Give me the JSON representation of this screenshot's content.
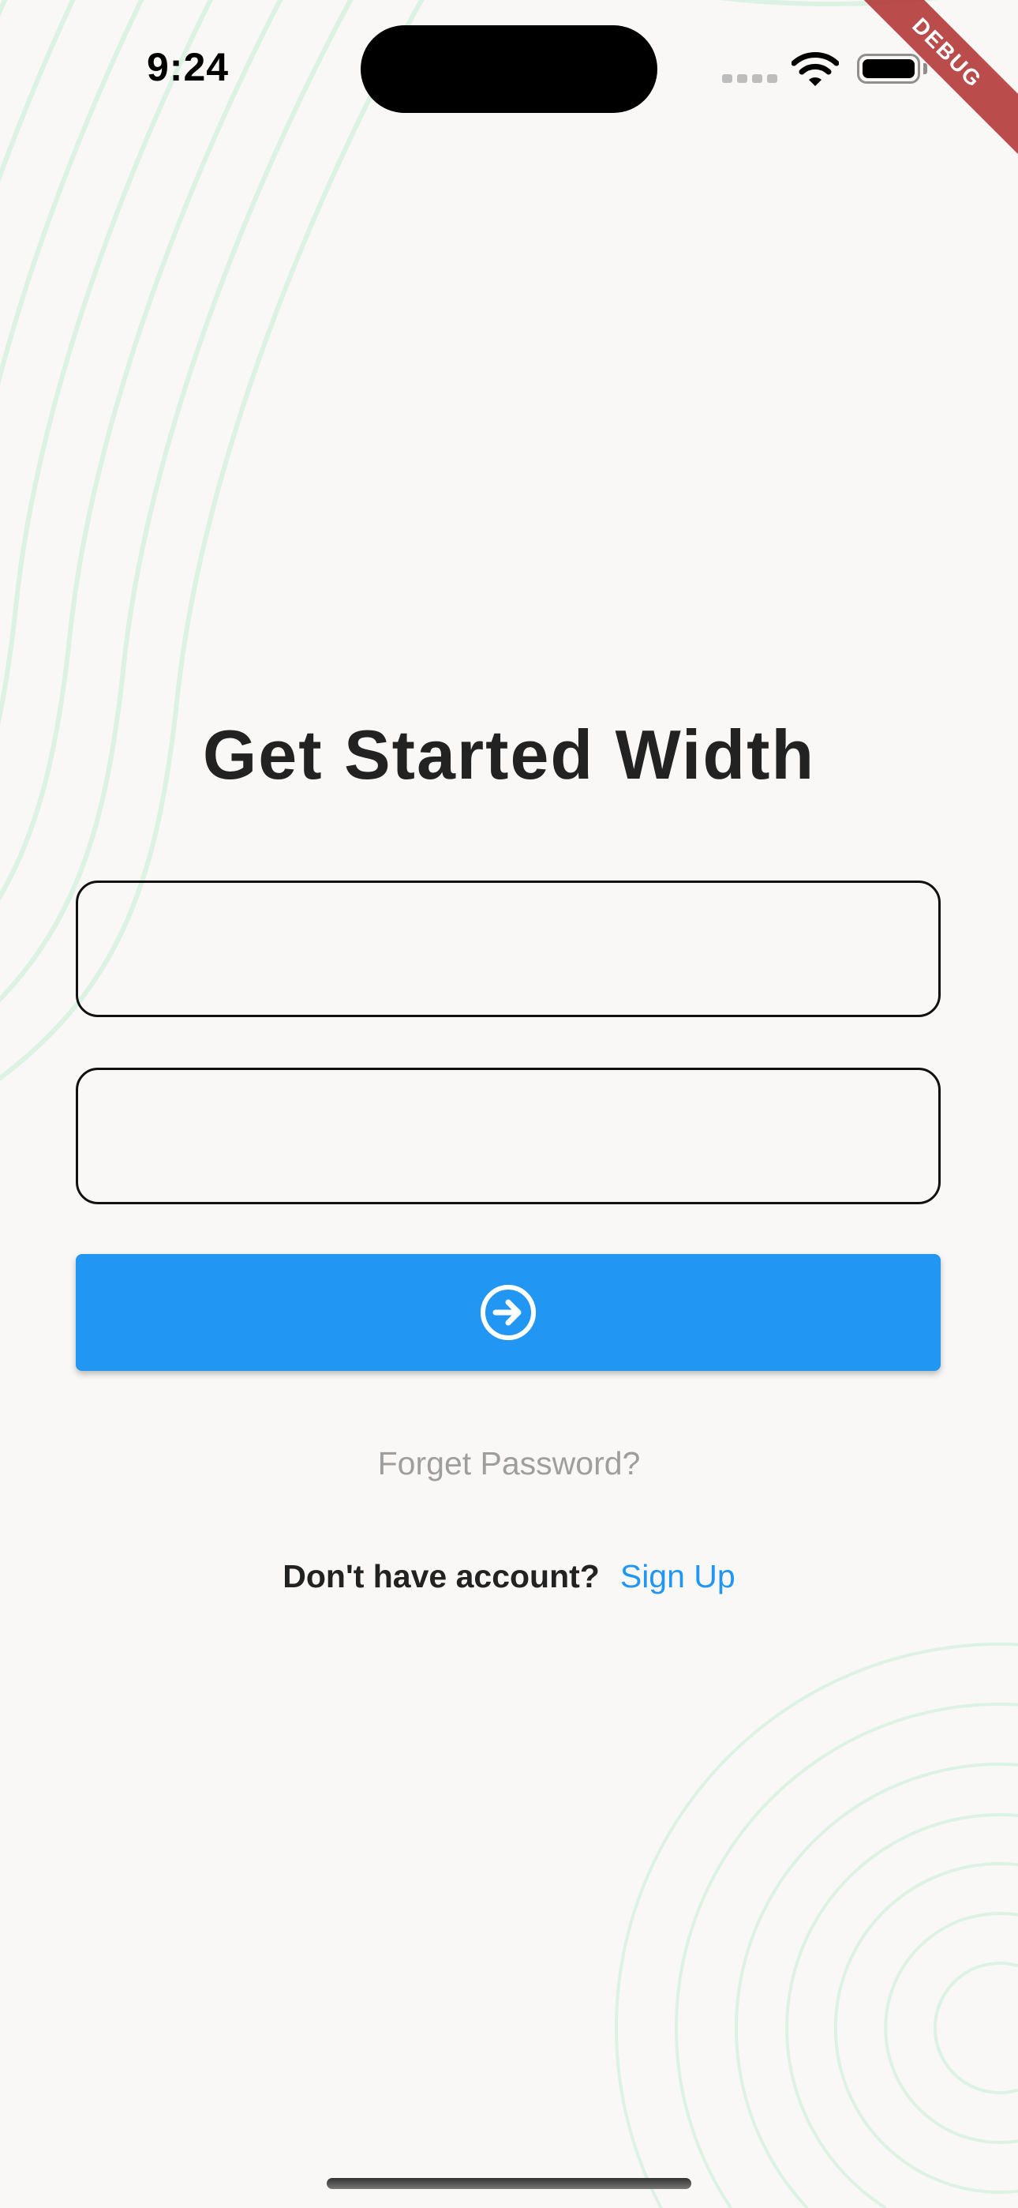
{
  "status_bar": {
    "time": "9:24",
    "wifi_icon": "wifi-icon",
    "battery_icon": "battery-icon"
  },
  "debug_banner": "DEBUG",
  "login": {
    "title": "Get Started Width",
    "field_1": {
      "value": "",
      "placeholder": ""
    },
    "field_2": {
      "value": "",
      "placeholder": ""
    },
    "submit_icon": "arrow-circle-right-icon",
    "forgot_password": "Forget Password?",
    "no_account": "Don't have account?",
    "sign_up": "Sign Up"
  },
  "colors": {
    "accent": "#2196F3",
    "background": "#F9F8F6",
    "decoration": "#DFF3E6",
    "muted_text": "#9E9E9E"
  }
}
